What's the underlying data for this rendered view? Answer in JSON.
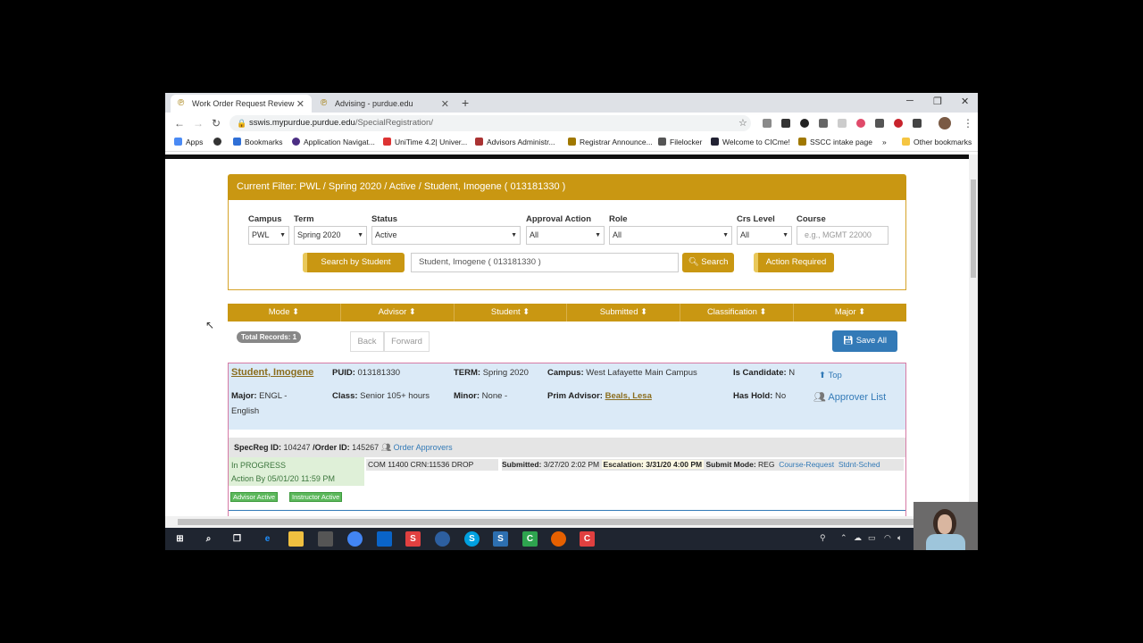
{
  "browser": {
    "tabs": [
      {
        "title": "Work Order Request Review",
        "active": true
      },
      {
        "title": "Advising - purdue.edu",
        "active": false
      }
    ],
    "url_host": "sswis.mypurdue.purdue.edu",
    "url_path": "/SpecialRegistration/",
    "bookmarks": [
      "Apps",
      "Bookmarks",
      "Application Navigat...",
      "UniTime 4.2| Univer...",
      "Advisors Administr...",
      "Registrar Announce...",
      "Filelocker",
      "Welcome to CICme!",
      "SSCC intake page",
      "»",
      "Other bookmarks"
    ]
  },
  "filter": {
    "header": "Current Filter: PWL / Spring 2020 / Active / Student, Imogene ( 013181330 )",
    "fields": {
      "campus": {
        "label": "Campus",
        "value": "PWL"
      },
      "term": {
        "label": "Term",
        "value": "Spring 2020"
      },
      "status": {
        "label": "Status",
        "value": "Active"
      },
      "approval": {
        "label": "Approval Action",
        "value": "All"
      },
      "role": {
        "label": "Role",
        "value": "All"
      },
      "crs_level": {
        "label": "Crs Level",
        "value": "All"
      },
      "course": {
        "label": "Course",
        "placeholder": "e.g., MGMT 22000"
      }
    },
    "search_by_student": "Search by Student",
    "student_value": "Student, Imogene ( 013181330 )",
    "search": "Search",
    "action_required": "Action Required"
  },
  "columns": [
    "Mode",
    "Advisor",
    "Student",
    "Submitted",
    "Classification",
    "Major"
  ],
  "total_records": "Total Records: 1",
  "back": "Back",
  "forward": "Forward",
  "save_all": "Save All",
  "record": {
    "name": "Student, Imogene",
    "puid_label": "PUID:",
    "puid": "013181330",
    "term_label": "TERM:",
    "term": "Spring 2020",
    "campus_label": "Campus:",
    "campus": "West Lafayette Main Campus",
    "candidate_label": "Is Candidate:",
    "candidate": "N",
    "top": "Top",
    "major_label": "Major:",
    "major": "ENGL -",
    "major2": "English",
    "class_label": "Class:",
    "class": "Senior 105+ hours",
    "minor_label": "Minor:",
    "minor": "None -",
    "advisor_label": "Prim Advisor:",
    "advisor": "Beals, Lesa",
    "hold_label": "Has Hold:",
    "hold": "No",
    "approver_list": "Approver List",
    "specreg_label": "SpecReg ID:",
    "specreg": "104247",
    "order_label": "/Order ID:",
    "order": "145267",
    "order_approvers": "Order Approvers",
    "status": "In PROGRESS",
    "action_by_label": "Action By",
    "action_by": "05/01/20 11:59 PM",
    "course": "COM 11400 CRN:11536  DROP",
    "submitted_label": "Submitted:",
    "submitted": "3/27/20 2:02 PM",
    "escalation": "Escalation: 3/31/20 4:00 PM",
    "mode_label": "Submit Mode:",
    "mode": "REG",
    "course_request": "Course-Request",
    "stdnt_sched": "Stdnt-Sched",
    "badge_advisor": "Advisor Active",
    "badge_instructor": "Instructor Active"
  },
  "colors": {
    "gold": "#c99712",
    "blue": "#337ab7",
    "record_bg": "#dbeaf7"
  }
}
